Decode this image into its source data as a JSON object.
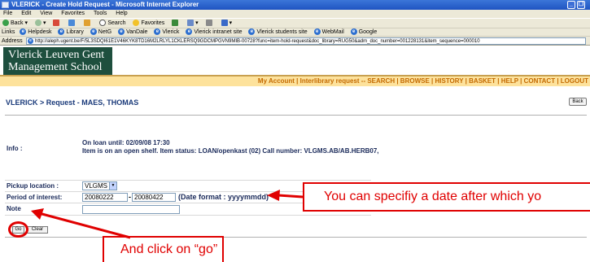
{
  "window": {
    "title": "VLERICK - Create Hold Request - Microsoft Internet Explorer",
    "minimize": "_",
    "restore": "❐"
  },
  "menu": [
    "File",
    "Edit",
    "View",
    "Favorites",
    "Tools",
    "Help"
  ],
  "toolbar": {
    "back": "Back",
    "search": "Search",
    "favorites": "Favorites"
  },
  "links": {
    "label": "Links",
    "items": [
      "Helpdesk",
      "Library",
      "NetG",
      "VanDale",
      "Vlerick",
      "Vlerick intranet site",
      "Vlerick students site",
      "WebMail",
      "Google"
    ]
  },
  "address": {
    "label": "Address",
    "url": "http://aleph.ugent.be/F/5L3SDQI61E1V46KYK8TD16M2LRLYL1CKLERSQ9GDCMPGVN9MIB-00728?func=item-hold-request&doc_library=RUG50&adm_doc_number=001228131&item_sequence=000010"
  },
  "logo": {
    "line1": "Vlerick Leuven Gent",
    "line2": "Management School"
  },
  "topnav": "My Account | Interlibrary request -- SEARCH | BROWSE | HISTORY | BASKET | HELP | CONTACT | LOGOUT",
  "breadcrumb": "VLERICK > Request - MAES, THOMAS",
  "back_button": "Back",
  "form": {
    "info_label": "Info :",
    "info_line1": "On loan until: 02/09/08 17:30",
    "info_line2": "Item is on an open shelf. Item status: LOAN/openkast (02) Call number: VLGMS.AB/AB.HERB07,",
    "pickup_label": "Pickup location :",
    "pickup_value": "VLGMS",
    "period_label": "Period of interest:",
    "period_from": "20080222",
    "period_dash": "-",
    "period_to": "20080422",
    "date_format": "(Date format : yyyymmdd)",
    "note_label": "Note",
    "note_value": "",
    "go_button": "Go",
    "clear_button": "Clear"
  },
  "annotations": {
    "callout_date": "You can specifiy a date after which yo",
    "callout_go": "And click on “go”",
    "color": "#e00000"
  }
}
